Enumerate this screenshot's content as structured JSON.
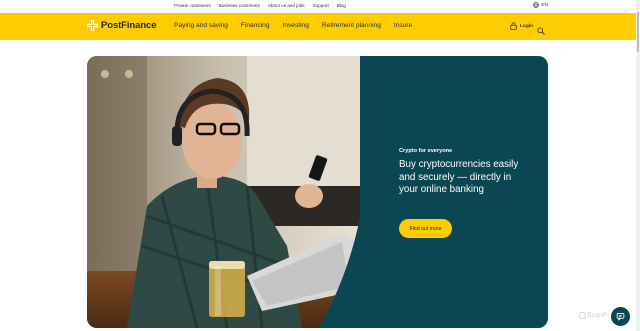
{
  "topbar": {
    "links": [
      "Private customers",
      "Business customers",
      "About us and jobs",
      "Support",
      "Blog"
    ],
    "language": "EN"
  },
  "header": {
    "logo_text": "PostFinance",
    "nav": [
      "Paying and saving",
      "Financing",
      "Investing",
      "Retirement planning",
      "Insure"
    ],
    "login_label": "Login"
  },
  "hero": {
    "eyebrow": "Crypto for everyone",
    "headline": "Buy cryptocurrencies easily and securely — directly in your online banking",
    "cta_label": "Find out more"
  },
  "watermark": "ScanFi",
  "colors": {
    "brand_yellow": "#ffcc00",
    "brand_teal": "#0a4752"
  },
  "icons": [
    "globe-icon",
    "lock-icon",
    "search-icon",
    "chat-icon",
    "postfinance-cross-icon"
  ]
}
